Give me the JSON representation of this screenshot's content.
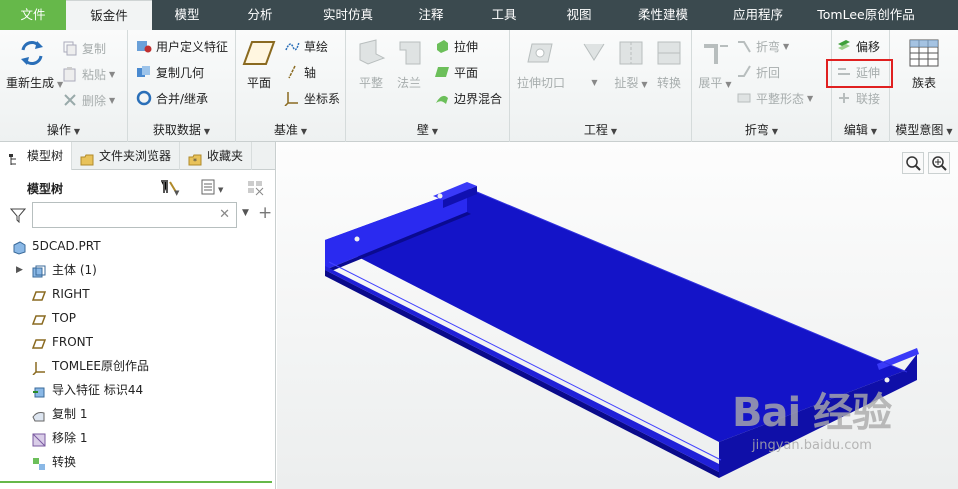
{
  "menu": {
    "tabs": [
      "文件",
      "钣金件",
      "模型",
      "分析",
      "实时仿真",
      "注释",
      "工具",
      "视图",
      "柔性建模",
      "应用程序",
      "TomLee原创作品"
    ],
    "active_tab": "钣金件"
  },
  "ribbon": {
    "operations": {
      "label": "操作",
      "regenerate": "重新生成",
      "copy": "复制",
      "paste": "粘贴",
      "delete": "删除"
    },
    "get_data": {
      "label": "获取数据",
      "udf": "用户定义特征",
      "copy_geom": "复制几何",
      "merge_inherit": "合并/继承"
    },
    "datum": {
      "label": "基准",
      "plane": "平面",
      "sketch": "草绘",
      "axis": "轴",
      "csys": "坐标系"
    },
    "wall": {
      "label": "壁",
      "flat": "平整",
      "flange": "法兰",
      "extrude": "拉伸",
      "planar": "平面",
      "boundary_blend": "边界混合"
    },
    "engineering": {
      "label": "工程",
      "extrude_cut": "拉伸切口",
      "rip": "扯裂",
      "convert": "转换"
    },
    "bend": {
      "label": "折弯",
      "unbend": "展平",
      "bend": "折弯",
      "bend_back": "折回",
      "flat_form": "平整形态"
    },
    "editing": {
      "label": "编辑",
      "offset": "偏移",
      "extend": "延伸",
      "join": "联接"
    },
    "model_intent": {
      "label": "模型意图",
      "family_table": "族表"
    }
  },
  "panel": {
    "tabs": [
      "模型树",
      "文件夹浏览器",
      "收藏夹"
    ],
    "tree_title": "模型树",
    "filter_placeholder": "",
    "nodes": [
      "5DCAD.PRT",
      "主体 (1)",
      "RIGHT",
      "TOP",
      "FRONT",
      "TOMLEE原创作品",
      "导入特征 标识44",
      "复制 1",
      "移除 1",
      "转换"
    ]
  },
  "watermark": {
    "main": "Bai 经验",
    "url": "jingyan.baidu.com"
  },
  "colors": {
    "menubar": "#3b4a4f",
    "file_tab": "#66b84a",
    "part": "#1414c8",
    "highlight": "#e02020"
  }
}
